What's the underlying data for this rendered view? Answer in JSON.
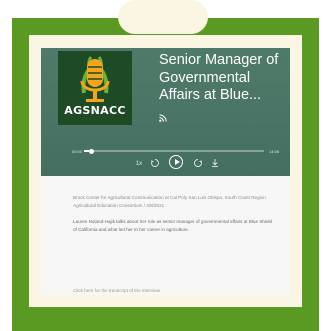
{
  "episode": {
    "title": "Senior Manager of Governmental Affairs at Blue...",
    "logo_text": "AGSNACC",
    "elapsed": "00:00",
    "duration": "14:06",
    "progress": 0.04,
    "speed_label": "1x",
    "source": "Brock Center for Agricultural Communication at Cal Poly San Luis Obispo, South Coast Region Agricultural Education Consortium",
    "date": "4/8/2021",
    "summary": "Lauren Noland-Hajik talks about her role as senior manager of governmental affairs at Blue Shield of California and what led her to her career in agriculture.",
    "more_text": "Click here for the transcript of the interview"
  },
  "icons": {
    "rss": "rss-icon",
    "rewind": "rewind-15-icon",
    "forward": "forward-15-icon",
    "play": "play-icon",
    "download": "download-icon"
  },
  "colors": {
    "frame_green": "#5b9a22",
    "paper": "#fbf6e3",
    "player_bg": "#4a7566",
    "logo_bg": "#1e4a25",
    "mic_orange": "#f3a520",
    "mic_green": "#6ab23a"
  }
}
